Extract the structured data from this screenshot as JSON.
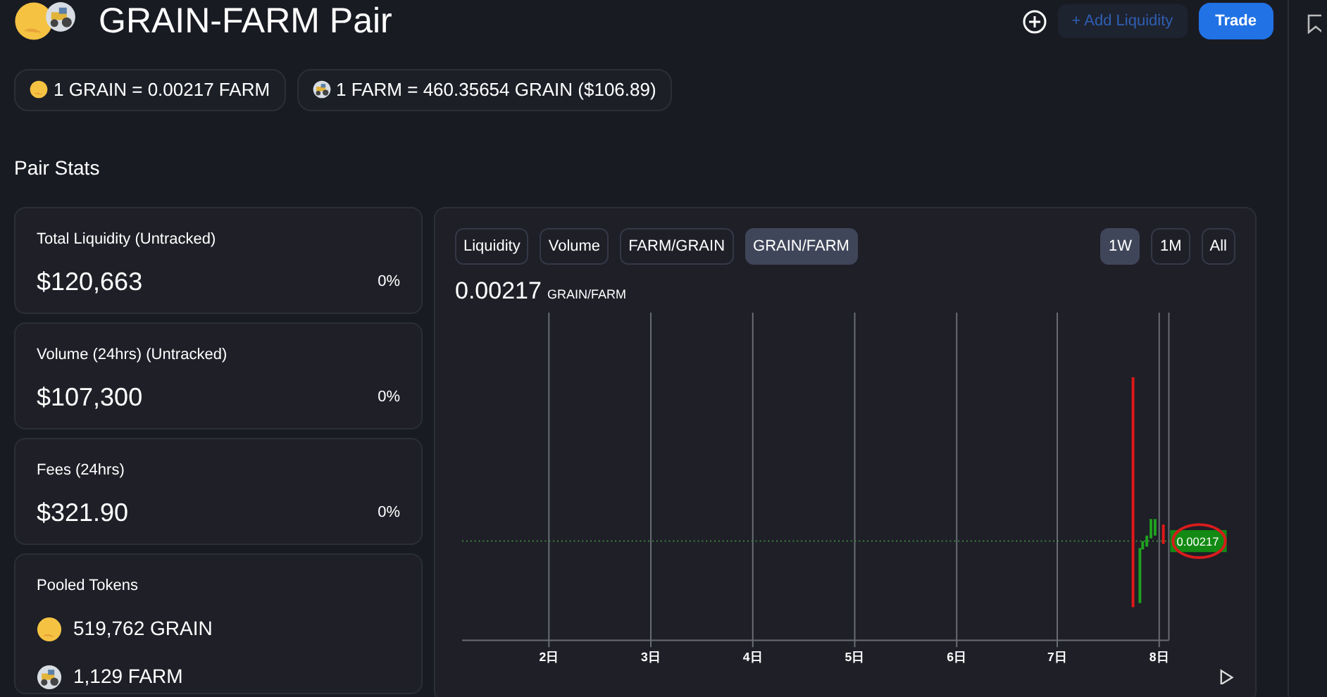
{
  "header": {
    "title": "GRAIN-FARM Pair",
    "add_liquidity": {
      "label": "+ Add Liquidity",
      "disabled": true
    },
    "trade": "Trade"
  },
  "rates": [
    {
      "kind": "grain",
      "text": "1 GRAIN = 0.00217 FARM"
    },
    {
      "kind": "farm",
      "text": "1 FARM = 460.35654 GRAIN ($106.89)"
    }
  ],
  "section_title": "Pair Stats",
  "stats": [
    {
      "label": "Total Liquidity (Untracked)",
      "value": "$120,663",
      "change": "0%"
    },
    {
      "label": "Volume (24hrs) (Untracked)",
      "value": "$107,300",
      "change": "0%"
    },
    {
      "label": "Fees (24hrs)",
      "value": "$321.90",
      "change": "0%"
    }
  ],
  "pooled": {
    "label": "Pooled Tokens",
    "tokens": [
      {
        "kind": "grain",
        "amount": "519,762 GRAIN"
      },
      {
        "kind": "farm",
        "amount": "1,129 FARM"
      }
    ]
  },
  "chart": {
    "views": [
      {
        "label": "Liquidity",
        "selected": false
      },
      {
        "label": "Volume",
        "selected": false
      },
      {
        "label": "FARM/GRAIN",
        "selected": false
      },
      {
        "label": "GRAIN/FARM",
        "selected": true
      }
    ],
    "ranges": [
      {
        "label": "1W",
        "selected": true
      },
      {
        "label": "1M",
        "selected": false
      },
      {
        "label": "All",
        "selected": false
      }
    ],
    "price": "0.00217",
    "unit": "GRAIN/FARM",
    "x_labels": [
      "2日",
      "3日",
      "4日",
      "5日",
      "6日",
      "7日",
      "8日"
    ],
    "price_label": "0.00217"
  }
}
